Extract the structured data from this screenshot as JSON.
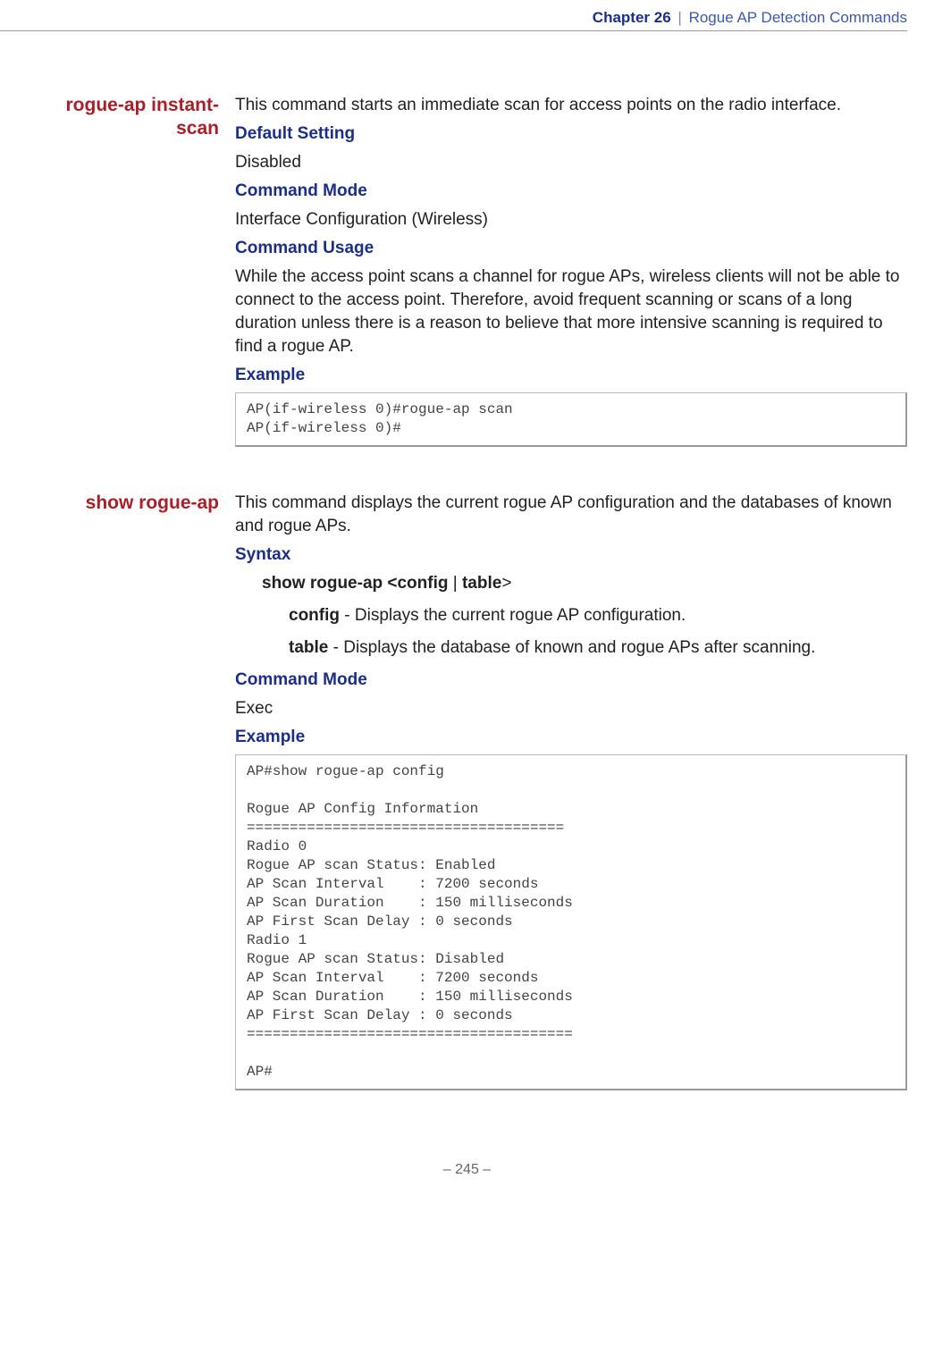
{
  "header": {
    "chapter_label": "Chapter 26",
    "separator": "|",
    "chapter_title": "Rogue AP Detection Commands"
  },
  "commands": [
    {
      "name": "rogue-ap instant-scan",
      "intro": "This command starts an immediate scan for access points on the radio interface.",
      "default_setting_label": "Default Setting",
      "default_setting_value": "Disabled",
      "command_mode_label": "Command Mode",
      "command_mode_value": "Interface Configuration (Wireless)",
      "usage_label": "Command Usage",
      "usage_text": "While the access point scans a channel for rogue APs, wireless clients will not be able to connect to the access point. Therefore, avoid frequent scanning or scans of a long duration unless there is a reason to believe that more intensive scanning is required to find a rogue AP.",
      "example_label": "Example",
      "example_code": "AP(if-wireless 0)#rogue-ap scan\nAP(if-wireless 0)#"
    },
    {
      "name": "show rogue-ap",
      "intro": "This command displays the current rogue AP configuration and the databases of known and rogue APs.",
      "syntax_label": "Syntax",
      "syntax_bold1": "show rogue-ap <config",
      "syntax_sep": " | ",
      "syntax_bold2": "table",
      "syntax_tail": ">",
      "params": [
        {
          "bold": "config",
          "desc": " - Displays the current rogue AP configuration."
        },
        {
          "bold": "table",
          "desc": " - Displays the database of known and rogue APs after scanning."
        }
      ],
      "command_mode_label": "Command Mode",
      "command_mode_value": "Exec",
      "example_label": "Example",
      "example_code": "AP#show rogue-ap config\n\nRogue AP Config Information\n=====================================\nRadio 0\nRogue AP scan Status: Enabled\nAP Scan Interval    : 7200 seconds\nAP Scan Duration    : 150 milliseconds\nAP First Scan Delay : 0 seconds\nRadio 1\nRogue AP scan Status: Disabled\nAP Scan Interval    : 7200 seconds\nAP Scan Duration    : 150 milliseconds\nAP First Scan Delay : 0 seconds\n======================================\n\nAP#"
    }
  ],
  "footer": {
    "page_number": "–  245  –"
  }
}
